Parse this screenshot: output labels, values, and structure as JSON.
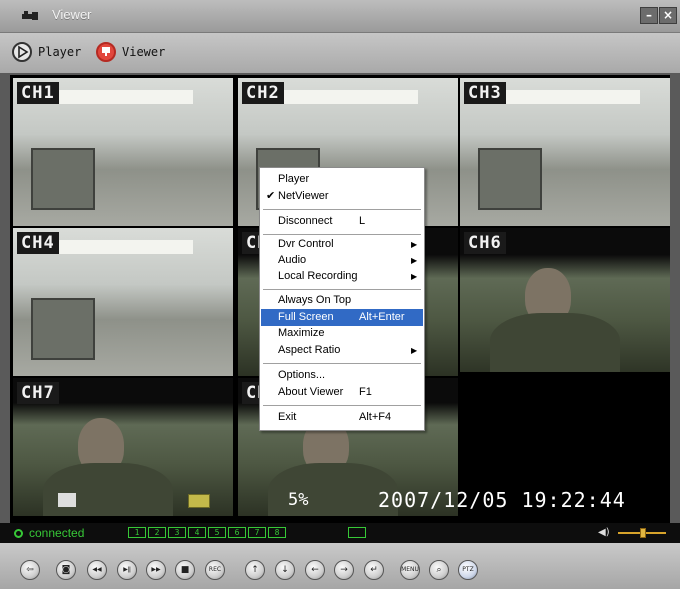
{
  "window": {
    "title": "Viewer",
    "icon": "app-logo-icon",
    "min_glyph": "–",
    "close_glyph": "×"
  },
  "modes": [
    {
      "label": "Player",
      "icon": "player-mode-icon"
    },
    {
      "label": "Viewer",
      "icon": "viewer-mode-icon"
    }
  ],
  "channels": [
    {
      "label": "CH1",
      "scene": "office"
    },
    {
      "label": "CH2",
      "scene": "office"
    },
    {
      "label": "CH3",
      "scene": "office"
    },
    {
      "label": "CH4",
      "scene": "office"
    },
    {
      "label": "CH5",
      "scene": "soldier"
    },
    {
      "label": "CH6",
      "scene": "soldier"
    },
    {
      "label": "CH7",
      "scene": "soldier"
    },
    {
      "label": "CH8",
      "scene": "soldier"
    }
  ],
  "osd": {
    "percent": "5%",
    "datetime": "2007/12/05 19:22:44"
  },
  "status": {
    "connection": "connected",
    "channel_buttons": [
      "1",
      "2",
      "3",
      "4",
      "5",
      "6",
      "7",
      "8"
    ],
    "volume_level": 0.45
  },
  "context_menu": {
    "items": [
      {
        "label": "Player",
        "shortcut": "",
        "checked": false,
        "submenu": false
      },
      {
        "label": "NetViewer",
        "shortcut": "",
        "checked": true,
        "submenu": false
      },
      {
        "label": "Disconnect",
        "shortcut": "L",
        "checked": false,
        "submenu": false
      },
      {
        "label": "Dvr Control",
        "shortcut": "",
        "checked": false,
        "submenu": true
      },
      {
        "label": "Audio",
        "shortcut": "",
        "checked": false,
        "submenu": true
      },
      {
        "label": "Local Recording",
        "shortcut": "",
        "checked": false,
        "submenu": true
      },
      {
        "label": "Always On Top",
        "shortcut": "",
        "checked": false,
        "submenu": false
      },
      {
        "label": "Full Screen",
        "shortcut": "Alt+Enter",
        "checked": false,
        "submenu": false,
        "highlighted": true
      },
      {
        "label": "Maximize",
        "shortcut": "",
        "checked": false,
        "submenu": false
      },
      {
        "label": "Aspect Ratio",
        "shortcut": "",
        "checked": false,
        "submenu": true
      },
      {
        "label": "Options...",
        "shortcut": "",
        "checked": false,
        "submenu": false
      },
      {
        "label": "About Viewer",
        "shortcut": "F1",
        "checked": false,
        "submenu": false
      },
      {
        "label": "Exit",
        "shortcut": "Alt+F4",
        "checked": false,
        "submenu": false
      }
    ],
    "check_glyph": "✔",
    "submenu_glyph": "▶"
  },
  "controls": [
    {
      "name": "back-button",
      "glyph": "⇦"
    },
    {
      "name": "snapshot-button",
      "glyph": "◙"
    },
    {
      "name": "rewind-button",
      "glyph": "◀◀"
    },
    {
      "name": "play-pause-button",
      "glyph": "▶ǁ"
    },
    {
      "name": "fast-forward-button",
      "glyph": "▶▶"
    },
    {
      "name": "stop-button",
      "glyph": "■"
    },
    {
      "name": "record-button",
      "glyph": "REC"
    },
    {
      "name": "ptz-up-button",
      "glyph": "↑"
    },
    {
      "name": "ptz-down-button",
      "glyph": "↓"
    },
    {
      "name": "ptz-left-button",
      "glyph": "←"
    },
    {
      "name": "ptz-right-button",
      "glyph": "→"
    },
    {
      "name": "enter-button",
      "glyph": "↵"
    },
    {
      "name": "menu-button",
      "glyph": "MENU"
    },
    {
      "name": "search-button",
      "glyph": "⌕"
    },
    {
      "name": "ptz-button",
      "glyph": "PTZ"
    }
  ]
}
